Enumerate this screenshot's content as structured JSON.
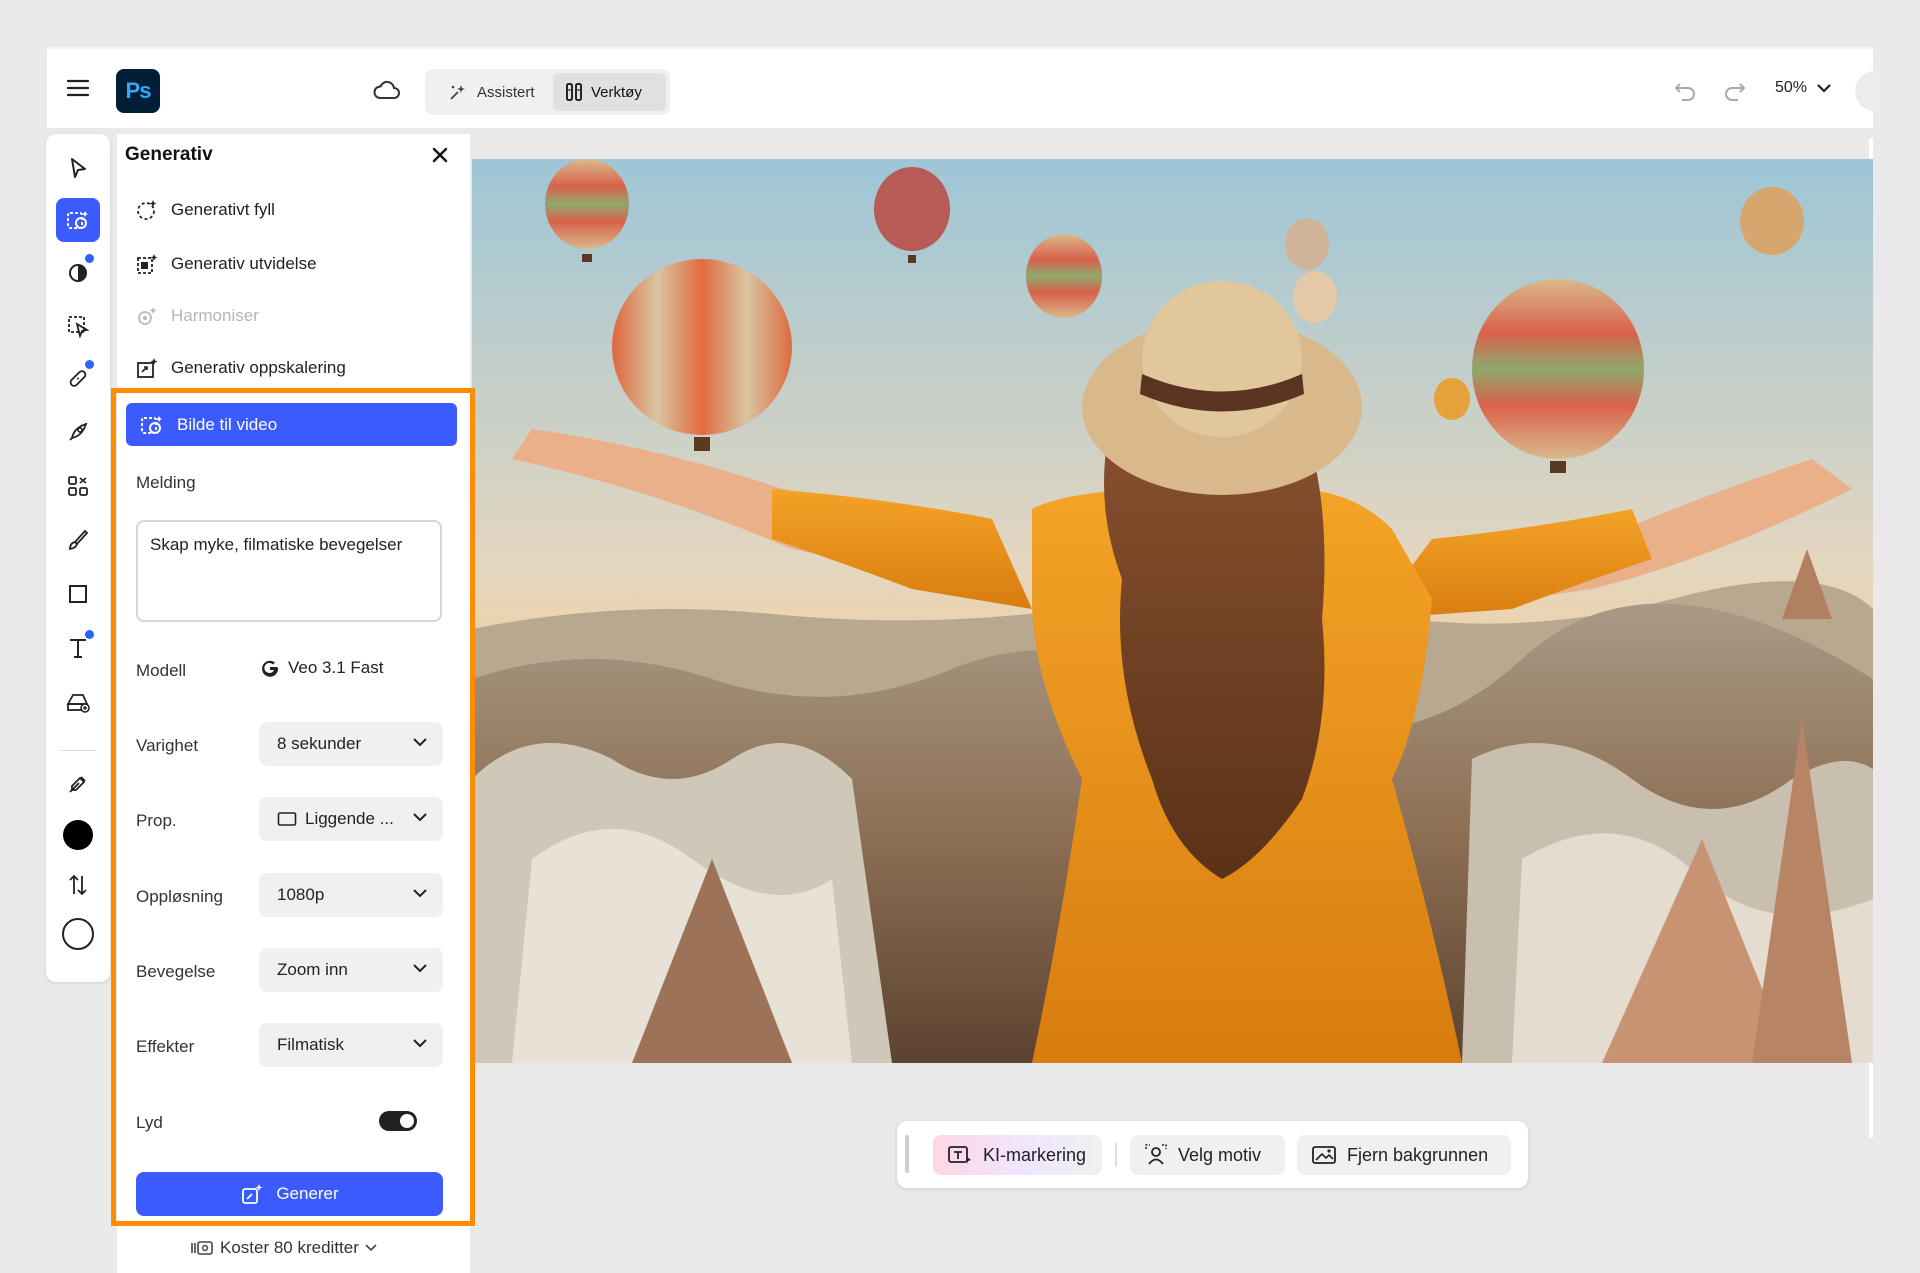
{
  "app": {
    "logo": "Ps"
  },
  "topbar": {
    "menu_icon": "hamburger-menu-icon",
    "cloud_icon": "cloud-icon",
    "modes": [
      {
        "label": "Assistert",
        "icon": "sparkle-wand-icon"
      },
      {
        "label": "Verktøy",
        "icon": "toolbox-icon",
        "selected": true
      }
    ],
    "undo_icon": "undo-icon",
    "redo_icon": "redo-icon",
    "zoom": "50%"
  },
  "panel": {
    "title": "Generativ",
    "items": [
      {
        "label": "Generativt fyll",
        "icon": "generative-fill-icon",
        "enabled": true
      },
      {
        "label": "Generativ utvidelse",
        "icon": "generative-expand-icon",
        "enabled": true
      },
      {
        "label": "Harmoniser",
        "icon": "harmonize-icon",
        "enabled": false
      },
      {
        "label": "Generativ oppskalering",
        "icon": "generative-upscale-icon",
        "enabled": true
      },
      {
        "label": "Bilde til video",
        "icon": "image-to-video-icon",
        "enabled": true,
        "active": true
      }
    ],
    "message_label": "Melding",
    "message_value": "Skap myke, filmatiske bevegelser",
    "model_label": "Modell",
    "model_value": "Veo 3.1 Fast",
    "duration_label": "Varighet",
    "duration_value": "8 sekunder",
    "aspect_label": "Prop.",
    "aspect_value": "Liggende ...",
    "resolution_label": "Oppløsning",
    "resolution_value": "1080p",
    "motion_label": "Bevegelse",
    "motion_value": "Zoom inn",
    "effects_label": "Effekter",
    "effects_value": "Filmatisk",
    "sound_label": "Lyd",
    "sound_on": true,
    "generate_label": "Generer",
    "cost_label": "Koster 80 kreditter"
  },
  "actionbar": {
    "ai_select": "KI-markering",
    "select_subject": "Velg motiv",
    "remove_bg": "Fjern bakgrunnen"
  },
  "colors": {
    "accent": "#3b5bff",
    "highlight_frame": "#ff8c00",
    "foreground_swatch": "#000000",
    "background_swatch": "#ffffff"
  }
}
